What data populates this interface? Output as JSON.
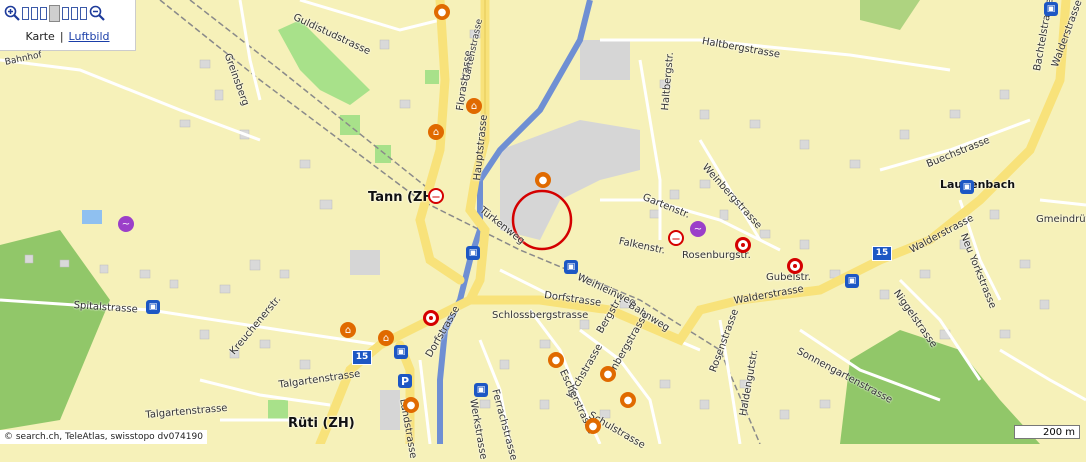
{
  "controls": {
    "zoom_in_icon": "zoom-in-magnifier",
    "zoom_out_icon": "zoom-out-magnifier",
    "zoom_levels": 7,
    "zoom_active_index": 4,
    "view_karte": "Karte",
    "separator": "|",
    "view_luftbild": "Luftbild"
  },
  "places": {
    "tann": "Tann (ZH)",
    "rueti": "Rüti (ZH)",
    "laupen": "Laupenbach",
    "laupen_prefix": "Lau"
  },
  "streets": {
    "guldistud": "Guldistudstrasse",
    "florastrasse": "Florastrasse",
    "hauptstrasse": "Hauptstrasse",
    "gartenstrasse": "Gartenstrasse",
    "haltbergstrasse": "Haltbergstrasse",
    "haltbergstr": "Haltbergstr.",
    "greinsberg": "Greinsberg",
    "bahnhof": "Bahnhof",
    "turkenweg": "Türkenweg",
    "weinbergstrasse": "Weinbergstrasse",
    "gartenstr": "Gartenstr.",
    "falkenstr": "Falkenstr.",
    "buechstrasse": "Buechstrasse",
    "bachtelstrasse": "Bachtelstrasse",
    "walderstrasse_top": "Walderstrasse",
    "rosenburgstr": "Rosenburgstr.",
    "gubelstr": "Gubelstr.",
    "walderstrasse_e": "Walderstrasse",
    "walderstrasse_mid": "Walderstrasse",
    "neu_yorkstrasse": "Neu Yorkstrasse",
    "gmeindruti": "Gmeindrütistr.",
    "weihleinweg": "Weihleinweg",
    "dorfstrasse_mid": "Dorfstrasse",
    "bahnweg": "Bahnweg",
    "spitalstrasse": "Spitalstrasse",
    "schlossbergstrasse": "Schlossbergstrasse",
    "dorfstrasse_w": "Dorfstrasse",
    "bergstr": "Bergstr.",
    "kirchstrasse": "Kirchstrasse",
    "enbergstrasse": "enbergstrasse",
    "rosenstrasse": "Rosenstrasse",
    "haldengutstr": "Haldengutstr.",
    "sonnengartenstrasse": "Sonnengartenstrasse",
    "niggelstrasse": "Niggelstrasse",
    "talgartenstrasse_upper": "Talgartenstrasse",
    "talgartenstrasse_lower": "Talgartenstrasse",
    "escherstrasse": "Escherstrasse",
    "ferrachstrasse": "Ferrachstrasse",
    "werkstrasse": "Werkstrasse",
    "landstrasse": "Landstrasse",
    "schulstrasse": "Schulstrasse",
    "kreuchenerstr": "Kreuchenerstr."
  },
  "route_shields": {
    "a": "15",
    "b": "15"
  },
  "footer": {
    "copyright": "© search.ch, TeleAtlas, swisstopo dv074190",
    "scale": "200 m"
  },
  "colors": {
    "background": "#f6f1b9",
    "main_road": "#f8e27a",
    "minor_road": "#ffffff",
    "river": "#6f8fd3",
    "forest": "#7fbf5a",
    "green_area": "#a8e18a",
    "building": "#d6d6d6",
    "rail": "#8a8a8a",
    "marker": "#d40000"
  }
}
